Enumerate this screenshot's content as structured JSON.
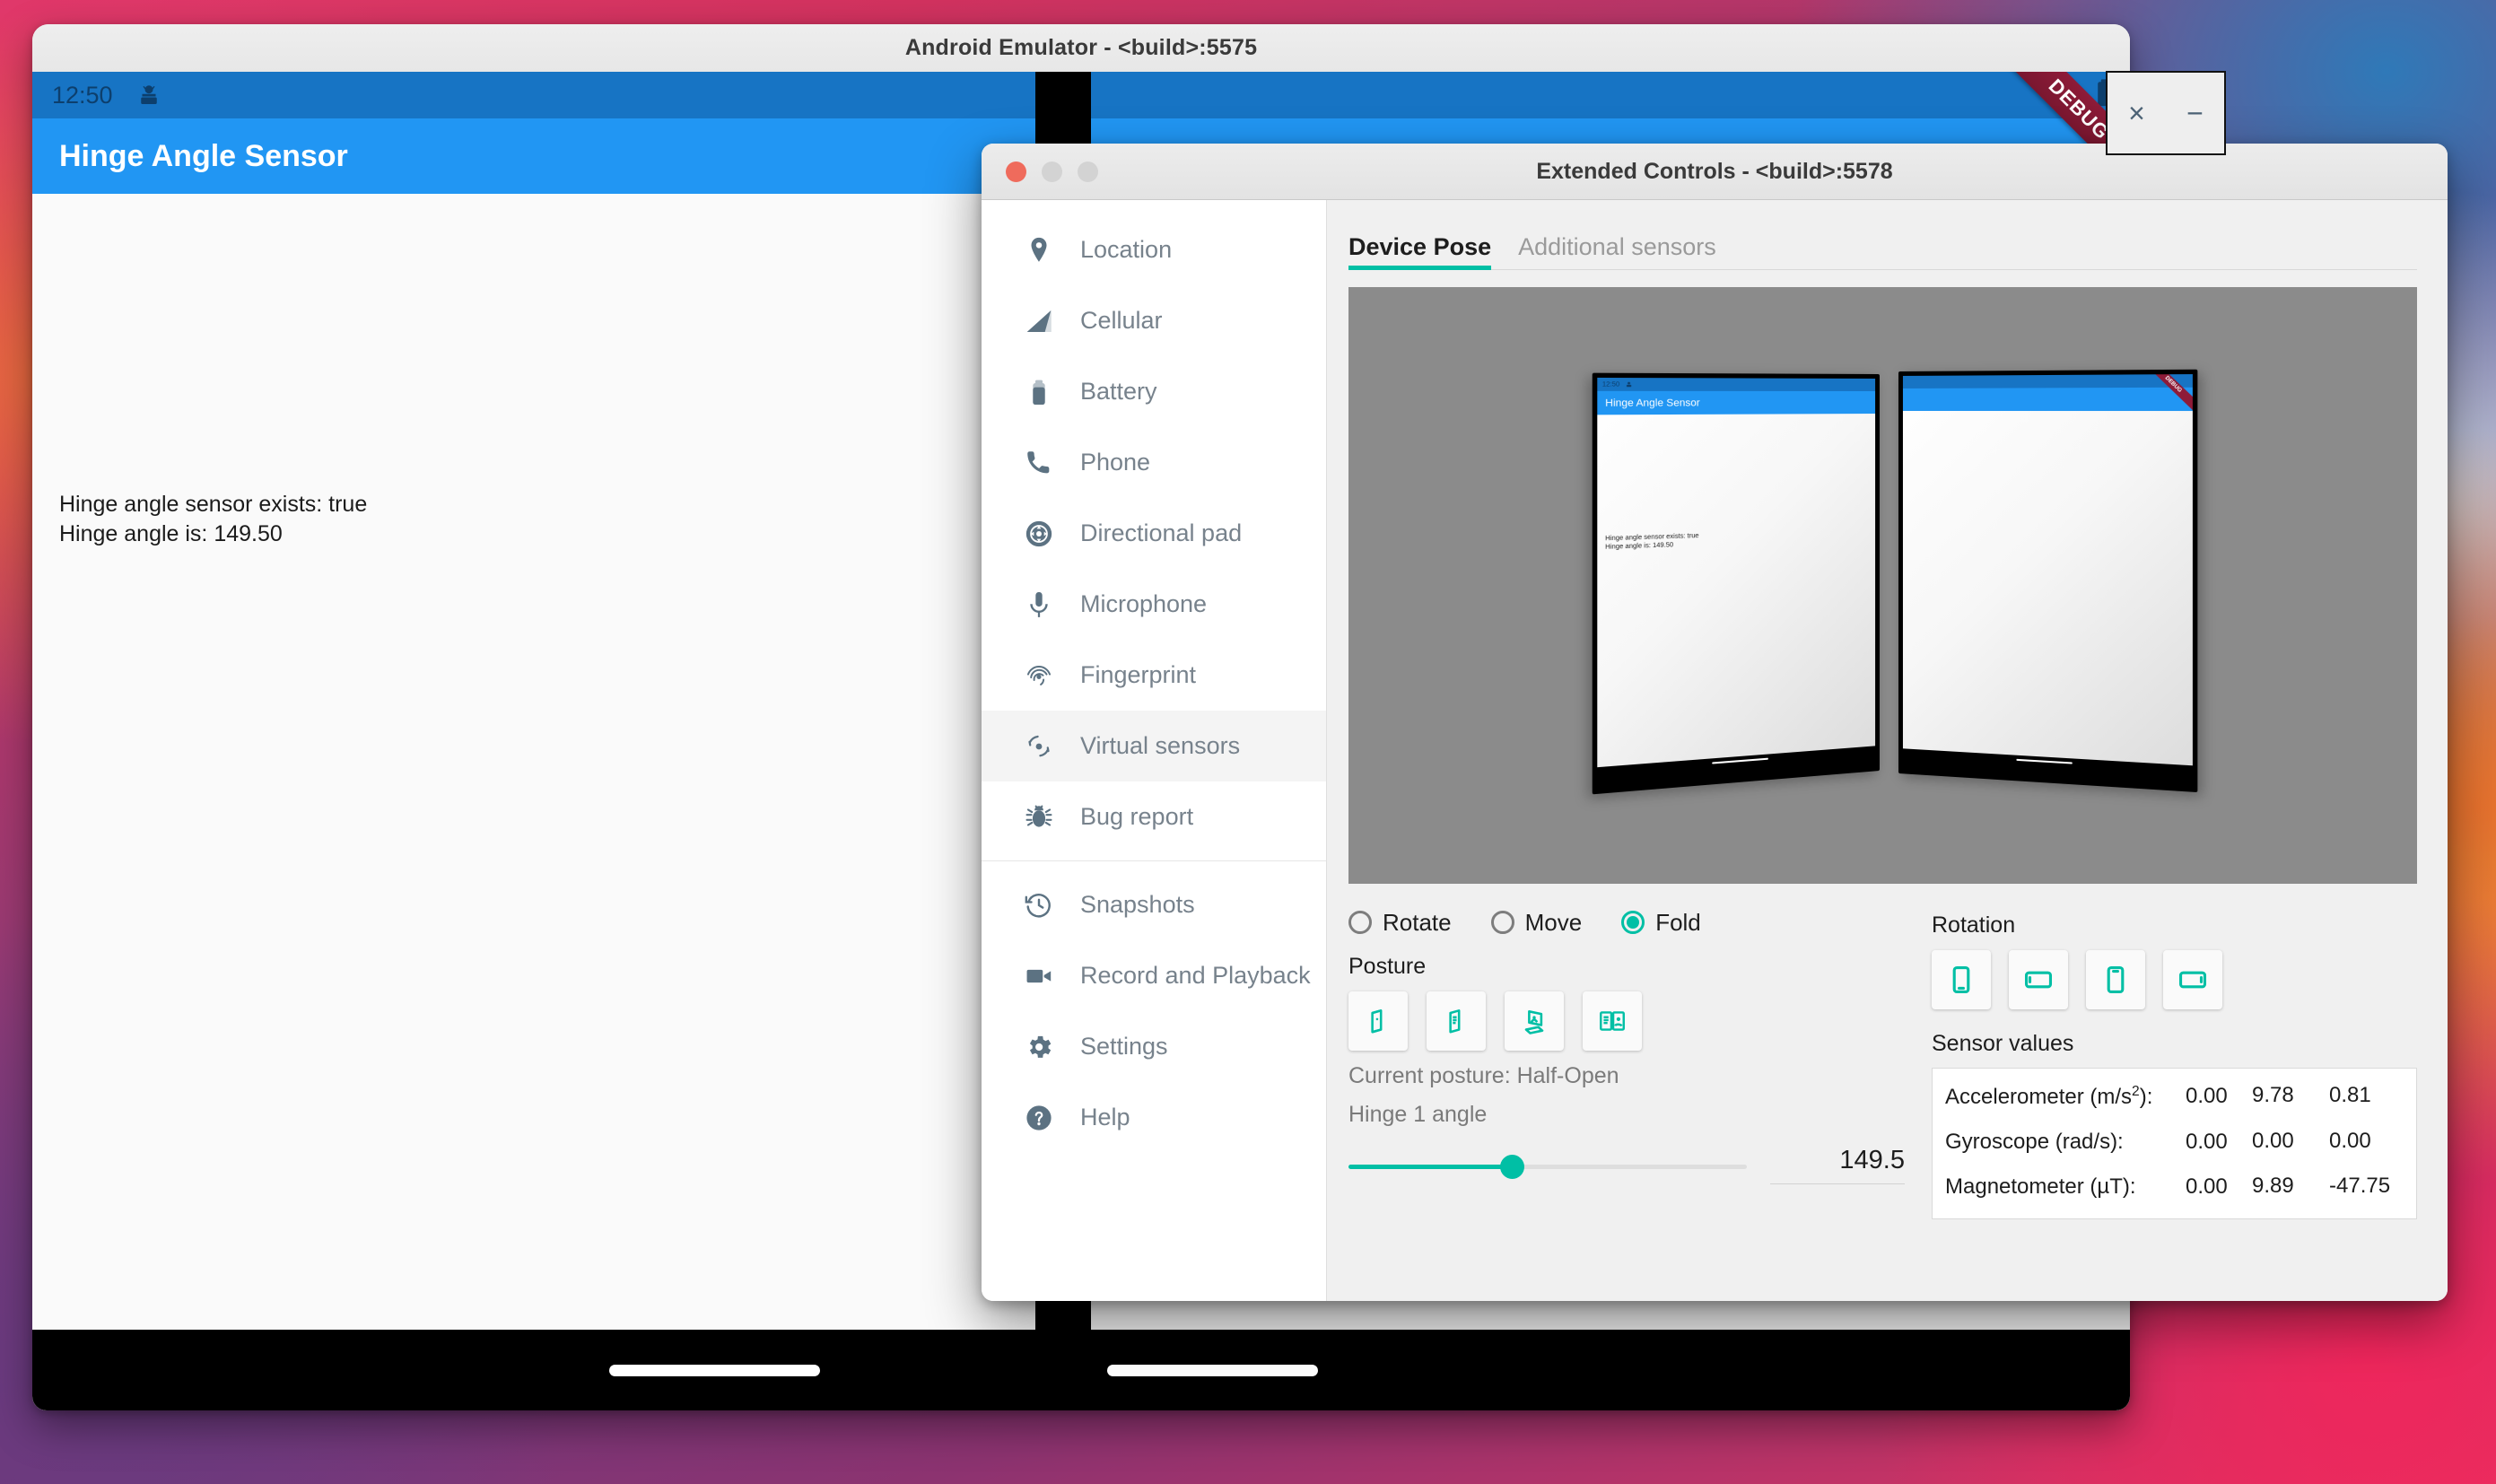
{
  "emulator": {
    "window_title": "Android Emulator - <build>:5575",
    "status_bar": {
      "clock": "12:50",
      "status_icon": "android-notification-icon"
    },
    "app_bar_title": "Hinge Angle Sensor",
    "content_lines": [
      "Hinge angle sensor exists: true",
      "Hinge angle is: 149.50"
    ],
    "debug_ribbon": "DEBUG",
    "float_controls": {
      "close": "×",
      "minimize": "−"
    }
  },
  "extended": {
    "window_title": "Extended Controls - <build>:5578",
    "traffic_lights": [
      "close",
      "minimize",
      "zoom"
    ],
    "sidebar": {
      "items": [
        {
          "label": "Location",
          "icon": "location-pin-icon",
          "active": false
        },
        {
          "label": "Cellular",
          "icon": "cellular-signal-icon",
          "active": false
        },
        {
          "label": "Battery",
          "icon": "battery-icon",
          "active": false
        },
        {
          "label": "Phone",
          "icon": "phone-icon",
          "active": false
        },
        {
          "label": "Directional pad",
          "icon": "dpad-icon",
          "active": false
        },
        {
          "label": "Microphone",
          "icon": "microphone-icon",
          "active": false
        },
        {
          "label": "Fingerprint",
          "icon": "fingerprint-icon",
          "active": false
        },
        {
          "label": "Virtual sensors",
          "icon": "virtual-sensors-icon",
          "active": true
        },
        {
          "label": "Bug report",
          "icon": "bug-icon",
          "active": false
        },
        {
          "label": "Snapshots",
          "icon": "history-clock-icon",
          "active": false
        },
        {
          "label": "Record and Playback",
          "icon": "video-camera-icon",
          "active": false
        },
        {
          "label": "Settings",
          "icon": "gear-icon",
          "active": false
        },
        {
          "label": "Help",
          "icon": "question-mark-icon",
          "active": false
        }
      ]
    },
    "tabs": [
      {
        "label": "Device Pose",
        "active": true
      },
      {
        "label": "Additional sensors",
        "active": false
      }
    ],
    "pose_preview": {
      "left_panel": {
        "clock": "12:50",
        "app_title": "Hinge Angle Sensor",
        "lines": [
          "Hinge angle sensor exists: true",
          "Hinge angle is: 149.50"
        ]
      },
      "right_panel": {
        "debug_ribbon": "DEBUG"
      }
    },
    "mode_radios": [
      {
        "label": "Rotate",
        "checked": false
      },
      {
        "label": "Move",
        "checked": false
      },
      {
        "label": "Fold",
        "checked": true
      }
    ],
    "posture": {
      "label": "Posture",
      "tiles": [
        {
          "name": "posture-closed-icon"
        },
        {
          "name": "posture-flipped-icon"
        },
        {
          "name": "posture-tent-icon"
        },
        {
          "name": "posture-open-icon"
        }
      ],
      "current_text": "Current posture: Half-Open",
      "hinge_label": "Hinge 1 angle",
      "hinge_value": "149.5",
      "hinge_percent": 41
    },
    "rotation": {
      "label": "Rotation",
      "tiles": [
        {
          "name": "rotation-portrait-icon"
        },
        {
          "name": "rotation-landscape-left-icon"
        },
        {
          "name": "rotation-portrait-upside-icon"
        },
        {
          "name": "rotation-landscape-right-icon"
        }
      ]
    },
    "sensor_values": {
      "label": "Sensor values",
      "rows": [
        {
          "name": "Accelerometer (m/s²):",
          "x": "0.00",
          "y": "9.78",
          "z": "0.81"
        },
        {
          "name": "Gyroscope (rad/s):",
          "x": "0.00",
          "y": "0.00",
          "z": "0.00"
        },
        {
          "name": "Magnetometer (µT):",
          "x": "0.00",
          "y": "9.89",
          "z": "-47.75"
        }
      ]
    }
  },
  "colors": {
    "accent_teal": "#00bfa5",
    "android_blue": "#2196f3",
    "status_blue": "#1774c4",
    "debug_maroon": "#8e1b38"
  }
}
